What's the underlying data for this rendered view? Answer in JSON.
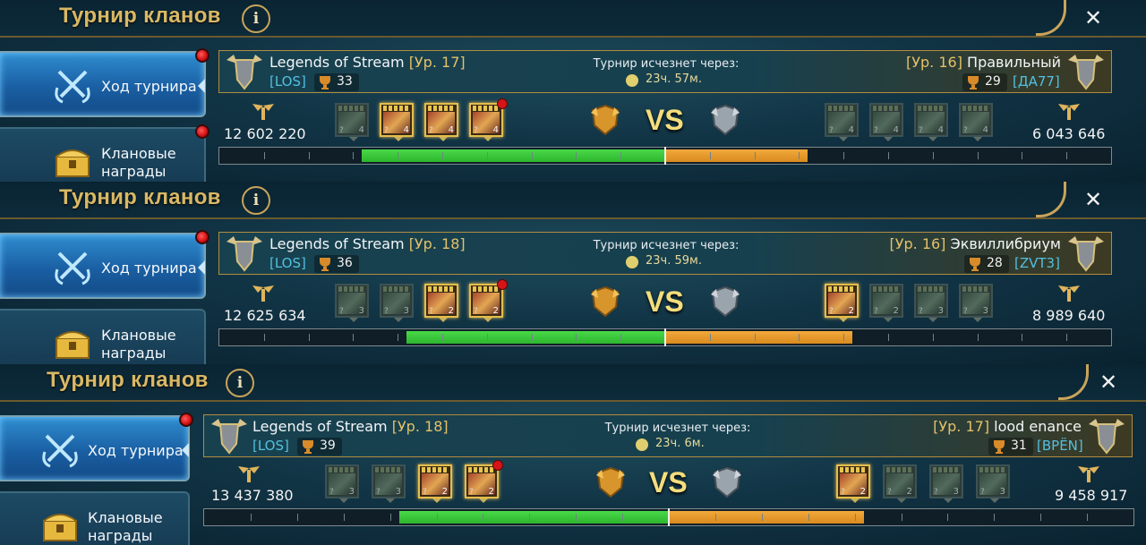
{
  "sections": [
    {
      "header": {
        "title": "Турнир кланов",
        "info": "i",
        "close": "✕"
      },
      "sidebar": [
        {
          "label": "Ход турнира",
          "icon": "crossed-swords-icon"
        },
        {
          "label": "Клановые награды",
          "icon": "treasure-chest-icon"
        }
      ],
      "left_clan": {
        "name": "Legends of Stream",
        "level": "[Ур. 17]",
        "tag": "[LOS]",
        "trophies": "33",
        "points": "12 602 220"
      },
      "right_clan": {
        "name": "Правильный",
        "level": "[Ур. 16]",
        "tag": "[ДА77]",
        "trophies": "29",
        "points": "6 043 646"
      },
      "timer": {
        "label": "Турнир исчезнет через:",
        "value": "23ч. 57м."
      },
      "vs": "VS",
      "left_cards": [
        {
          "active": false,
          "level": "4"
        },
        {
          "active": true,
          "level": "4"
        },
        {
          "active": true,
          "level": "4"
        },
        {
          "active": true,
          "level": "4"
        }
      ],
      "right_cards": [
        {
          "active": false,
          "level": "4"
        },
        {
          "active": false,
          "level": "4"
        },
        {
          "active": false,
          "level": "4"
        },
        {
          "active": false,
          "level": "4"
        }
      ],
      "progress": {
        "left_fraction": 0.34,
        "right_fraction": 0.16
      }
    },
    {
      "header": {
        "title": "Турнир кланов",
        "info": "i",
        "close": "✕"
      },
      "sidebar": [
        {
          "label": "Ход турнира",
          "icon": "crossed-swords-icon"
        },
        {
          "label": "Клановые награды",
          "icon": "treasure-chest-icon"
        }
      ],
      "left_clan": {
        "name": "Legends of Stream",
        "level": "[Ур. 18]",
        "tag": "[LOS]",
        "trophies": "36",
        "points": "12 625 634"
      },
      "right_clan": {
        "name": "Эквиллибриум",
        "level": "[Ур. 16]",
        "tag": "[ZVT3]",
        "trophies": "28",
        "points": "8 989 640"
      },
      "timer": {
        "label": "Турнир исчезнет через:",
        "value": "23ч. 59м."
      },
      "vs": "VS",
      "left_cards": [
        {
          "active": false,
          "level": "3"
        },
        {
          "active": false,
          "level": "3"
        },
        {
          "active": true,
          "level": "2"
        },
        {
          "active": true,
          "level": "2"
        }
      ],
      "right_cards": [
        {
          "active": true,
          "level": "2"
        },
        {
          "active": false,
          "level": "2"
        },
        {
          "active": false,
          "level": "3"
        },
        {
          "active": false,
          "level": "3"
        }
      ],
      "progress": {
        "left_fraction": 0.29,
        "right_fraction": 0.21
      }
    },
    {
      "header": {
        "title": "Турнир кланов",
        "info": "i",
        "close": "✕"
      },
      "sidebar": [
        {
          "label": "Ход турнира",
          "icon": "crossed-swords-icon"
        },
        {
          "label": "Клановые награды",
          "icon": "treasure-chest-icon"
        }
      ],
      "left_clan": {
        "name": "Legends of Stream",
        "level": "[Ур. 18]",
        "tag": "[LOS]",
        "trophies": "39",
        "points": "13 437 380"
      },
      "right_clan": {
        "name": "lood  enance",
        "level": "[Ур. 17]",
        "tag": "[BPЁN]",
        "trophies": "31",
        "points": "9 458 917"
      },
      "timer": {
        "label": "Турнир исчезнет через:",
        "value": "23ч. 6м."
      },
      "vs": "VS",
      "left_cards": [
        {
          "active": false,
          "level": "3"
        },
        {
          "active": false,
          "level": "3"
        },
        {
          "active": true,
          "level": "2"
        },
        {
          "active": true,
          "level": "2"
        }
      ],
      "right_cards": [
        {
          "active": true,
          "level": "2"
        },
        {
          "active": false,
          "level": "2"
        },
        {
          "active": false,
          "level": "3"
        },
        {
          "active": false,
          "level": "3"
        }
      ],
      "progress": {
        "left_fraction": 0.29,
        "right_fraction": 0.21
      }
    }
  ]
}
